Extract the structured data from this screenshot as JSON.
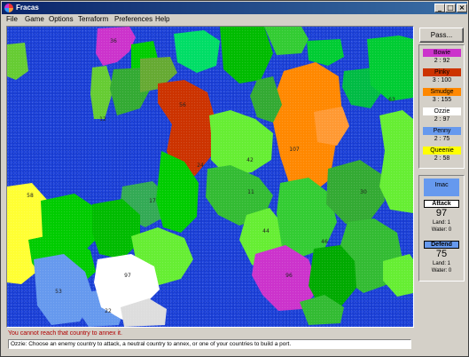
{
  "window": {
    "title": "Fracas"
  },
  "menu": [
    "File",
    "Game",
    "Options",
    "Terraform",
    "Preferences",
    "Help"
  ],
  "pass_button": "Pass...",
  "players": [
    {
      "name": "Bowie",
      "score": "2 : 92",
      "color": "#cc33cc"
    },
    {
      "name": "Pinky",
      "score": "3 : 100",
      "color": "#cc3300"
    },
    {
      "name": "Smudge",
      "score": "3 : 155",
      "color": "#ff8800"
    },
    {
      "name": "Ozzie",
      "score": "2 : 97",
      "color": "#ffffff"
    },
    {
      "name": "Penny",
      "score": "2 : 75",
      "color": "#6699ee"
    },
    {
      "name": "Queenie",
      "score": "2 : 58",
      "color": "#ffff00"
    }
  ],
  "combat": {
    "current_player": "Imac",
    "attack": {
      "label": "Attack",
      "value": "97",
      "land": "Land: 1",
      "water": "Water: 0"
    },
    "defend": {
      "label": "Defend",
      "value": "75",
      "land": "Land: 1",
      "water": "Water: 0"
    }
  },
  "map_labels": [
    "36",
    "12",
    "56",
    "24",
    "42",
    "107",
    "11",
    "17",
    "44",
    "46",
    "30",
    "63",
    "58",
    "97",
    "53",
    "22",
    "96"
  ],
  "status_message": "You cannot reach that country to annex it.",
  "instructions": "Ozzie: Choose an enemy country to attack, a neutral country to annex, or one of your countries to build a port.",
  "colors": {
    "ocean": "#1a3fd6",
    "title_bar": "#0a246a",
    "status_text": "#b00000"
  }
}
